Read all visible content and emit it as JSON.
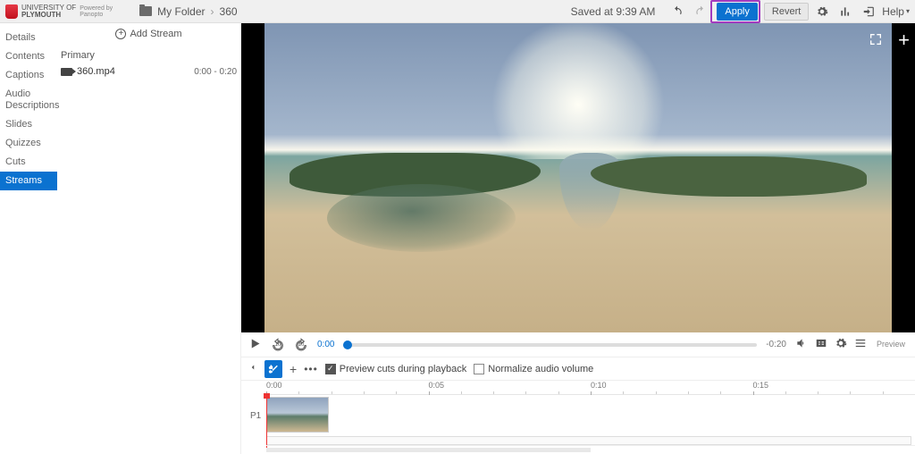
{
  "brand": {
    "line1": "UNIVERSITY OF",
    "line2": "PLYMOUTH",
    "powered1": "Powered by",
    "powered2": "Panopto"
  },
  "breadcrumb": {
    "folder": "My Folder",
    "session": "360"
  },
  "topbar": {
    "saved": "Saved at 9:39 AM",
    "apply": "Apply",
    "revert": "Revert",
    "help": "Help"
  },
  "sidebar": {
    "items": [
      "Details",
      "Contents",
      "Captions",
      "Audio Descriptions",
      "Slides",
      "Quizzes",
      "Cuts",
      "Streams"
    ],
    "active_index": 7
  },
  "streams": {
    "add": "Add Stream",
    "group": "Primary",
    "file": "360.mp4",
    "range": "0:00 - 0:20"
  },
  "player": {
    "current": "0:00",
    "remaining": "-0:20",
    "rewind_secs": "10",
    "preview_word": "Preview"
  },
  "timeline_tools": {
    "preview_cuts": "Preview cuts during playback",
    "normalize": "Normalize audio volume"
  },
  "ruler": {
    "marks": [
      "0:00",
      "0:05",
      "0:10",
      "0:15"
    ]
  },
  "track": {
    "label": "P1"
  }
}
